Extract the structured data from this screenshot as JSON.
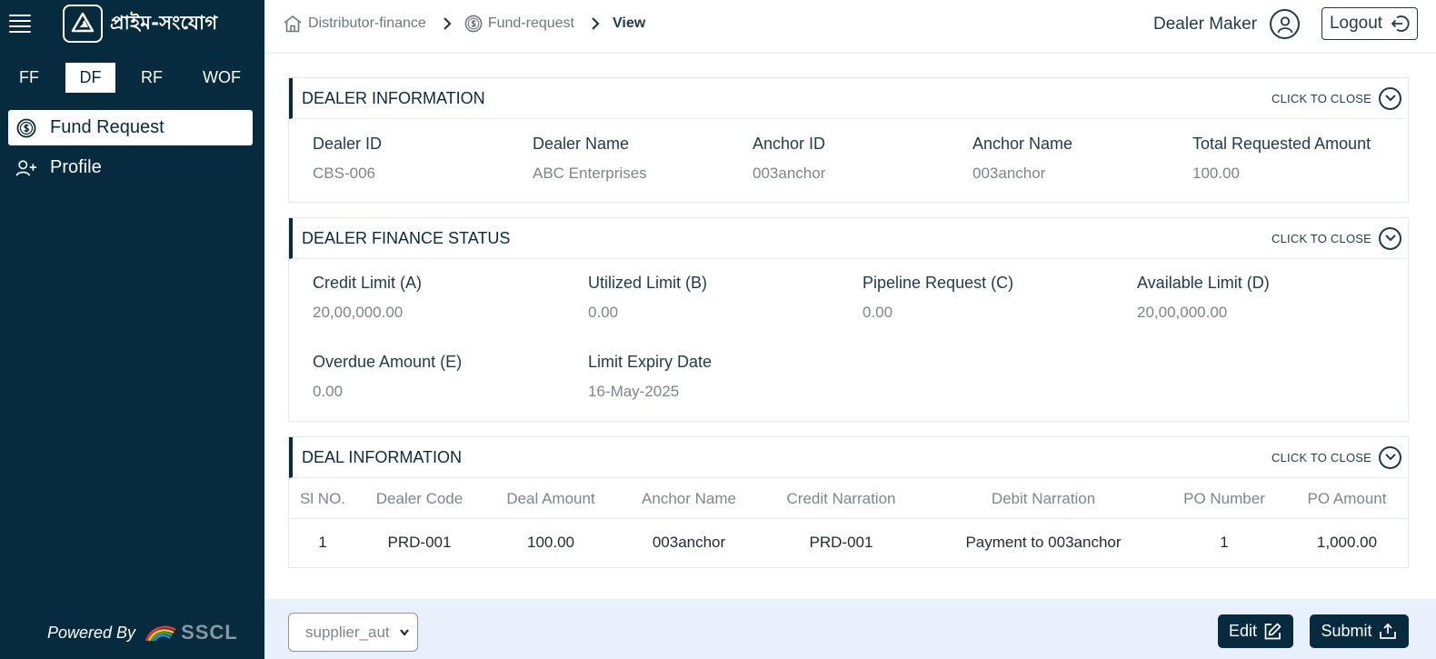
{
  "brand": {
    "name": "প্রাইম-সংযোগ"
  },
  "module_tabs": [
    {
      "label": "FF"
    },
    {
      "label": "DF"
    },
    {
      "label": "RF"
    },
    {
      "label": "WOF"
    }
  ],
  "active_module": "DF",
  "nav": [
    {
      "label": "Fund Request",
      "icon": "dollar-circle-icon",
      "active": true
    },
    {
      "label": "Profile",
      "icon": "user-plus-icon",
      "active": false
    }
  ],
  "powered_by": {
    "label": "Powered By",
    "logo_text": "SSCL"
  },
  "breadcrumb": [
    {
      "label": "Distributor-finance",
      "icon": "home-icon"
    },
    {
      "label": "Fund-request",
      "icon": "dollar-circle-icon"
    },
    {
      "label": "View"
    }
  ],
  "header": {
    "user_name": "Dealer Maker",
    "logout_label": "Logout"
  },
  "toggle_label": "CLICK TO CLOSE",
  "dealer_info": {
    "title": "DEALER INFORMATION",
    "fields": [
      {
        "label": "Dealer ID",
        "value": "CBS-006"
      },
      {
        "label": "Dealer Name",
        "value": "ABC Enterprises"
      },
      {
        "label": "Anchor ID",
        "value": "003anchor"
      },
      {
        "label": "Anchor Name",
        "value": "003anchor"
      },
      {
        "label": "Total Requested Amount",
        "value": "100.00"
      }
    ]
  },
  "finance_status": {
    "title": "DEALER FINANCE STATUS",
    "fields": [
      {
        "label": "Credit Limit (A)",
        "value": "20,00,000.00"
      },
      {
        "label": "Utilized Limit (B)",
        "value": "0.00"
      },
      {
        "label": "Pipeline Request (C)",
        "value": "0.00"
      },
      {
        "label": "Available Limit (D)",
        "value": "20,00,000.00"
      },
      {
        "label": "Overdue Amount (E)",
        "value": "0.00"
      },
      {
        "label": "Limit Expiry Date",
        "value": "16-May-2025"
      }
    ]
  },
  "deal_info": {
    "title": "DEAL INFORMATION",
    "columns": [
      "Sl NO.",
      "Dealer Code",
      "Deal Amount",
      "Anchor Name",
      "Credit Narration",
      "Debit Narration",
      "PO Number",
      "PO Amount"
    ],
    "rows": [
      [
        "1",
        "PRD-001",
        "100.00",
        "003anchor",
        "PRD-001",
        "Payment to 003anchor",
        "1",
        "1,000.00"
      ]
    ]
  },
  "footer": {
    "select_value": "supplier_authorizer",
    "edit_label": "Edit",
    "submit_label": "Submit"
  },
  "colors": {
    "sidebar": "#062a3e",
    "footer": "#e7f0fb",
    "accent": "#062a3e"
  }
}
